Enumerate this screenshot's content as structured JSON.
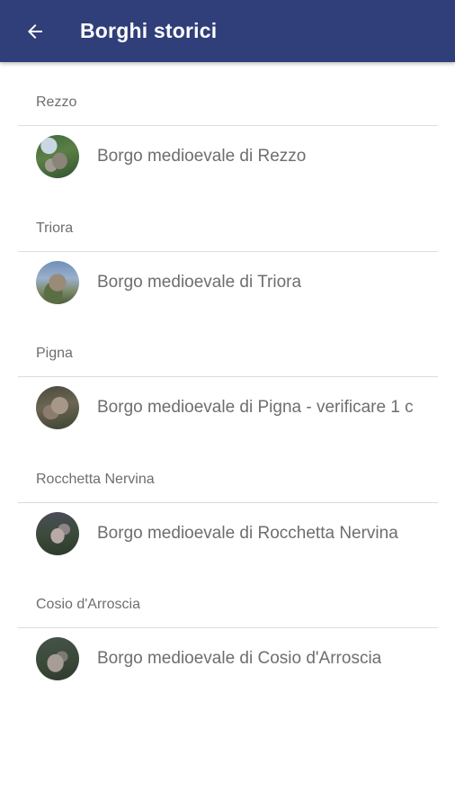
{
  "appbar": {
    "title": "Borghi storici",
    "background": "#303f7a",
    "back_icon": "arrow-left-icon"
  },
  "sections": [
    {
      "header": "Rezzo",
      "item": {
        "title": "Borgo medioevale di Rezzo",
        "avatar": "village-photo"
      }
    },
    {
      "header": "Triora",
      "item": {
        "title": "Borgo medioevale di Triora",
        "avatar": "village-photo"
      }
    },
    {
      "header": "Pigna",
      "item": {
        "title": "Borgo medioevale di Pigna - verificare 1 c",
        "avatar": "village-photo"
      }
    },
    {
      "header": "Rocchetta Nervina",
      "item": {
        "title": "Borgo medioevale di Rocchetta Nervina",
        "avatar": "village-photo"
      }
    },
    {
      "header": "Cosio d'Arroscia",
      "item": {
        "title": "Borgo medioevale di Cosio d'Arroscia",
        "avatar": "village-photo"
      }
    }
  ]
}
